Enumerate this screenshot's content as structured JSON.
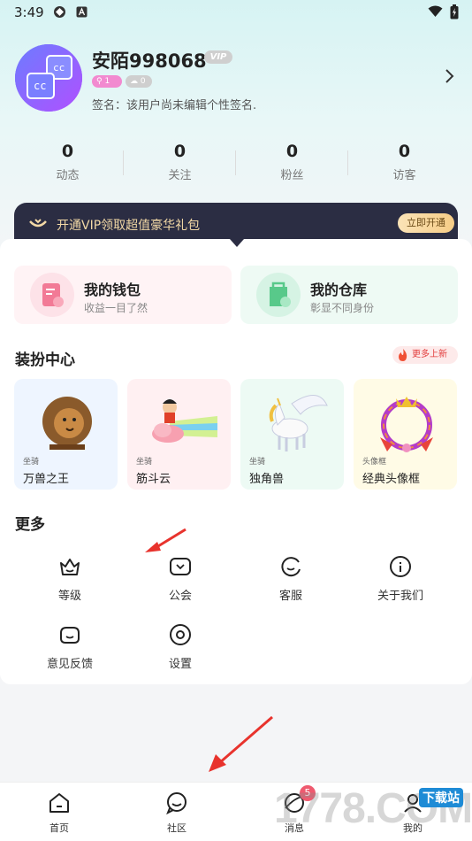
{
  "status_bar": {
    "time": "3:49"
  },
  "profile": {
    "name": "安陌998068",
    "vip_badge": "VIP",
    "badge_level": "1",
    "badge_gray": "0",
    "signature": "签名：该用户尚未编辑个性签名."
  },
  "stats": [
    {
      "value": "0",
      "label": "动态"
    },
    {
      "value": "0",
      "label": "关注"
    },
    {
      "value": "0",
      "label": "粉丝"
    },
    {
      "value": "0",
      "label": "访客"
    }
  ],
  "vip_banner": {
    "text": "开通VIP领取超值豪华礼包",
    "button": "立即开通"
  },
  "features": [
    {
      "title": "我的钱包",
      "subtitle": "收益一目了然"
    },
    {
      "title": "我的仓库",
      "subtitle": "彰显不同身份"
    }
  ],
  "dressup": {
    "title": "装扮中心",
    "hot_label": "更多上新",
    "items": [
      {
        "tag": "坐骑",
        "name": "万兽之王",
        "icon": "lion-icon"
      },
      {
        "tag": "坐骑",
        "name": "筋斗云",
        "icon": "cloud-rider-icon"
      },
      {
        "tag": "坐骑",
        "name": "独角兽",
        "icon": "unicorn-icon"
      },
      {
        "tag": "头像框",
        "name": "经典头像框",
        "icon": "avatar-frame-icon"
      }
    ]
  },
  "more": {
    "title": "更多",
    "items": [
      {
        "label": "等级",
        "icon": "crown-icon"
      },
      {
        "label": "公会",
        "icon": "shield-icon"
      },
      {
        "label": "客服",
        "icon": "service-icon"
      },
      {
        "label": "关于我们",
        "icon": "info-icon"
      },
      {
        "label": "意见反馈",
        "icon": "feedback-icon"
      },
      {
        "label": "设置",
        "icon": "settings-icon"
      }
    ]
  },
  "bottom_nav": {
    "items": [
      {
        "label": "首页",
        "icon": "home-icon"
      },
      {
        "label": "社区",
        "icon": "community-icon"
      },
      {
        "label": "消息",
        "icon": "message-icon",
        "badge": "5"
      },
      {
        "label": "我的",
        "icon": "profile-icon"
      }
    ]
  },
  "watermark": {
    "text": "1778.COM",
    "tag": "下载站"
  },
  "colors": {
    "accent_teal": "#d6f3f3",
    "vip_dark": "#2b2d43",
    "gold": "#f6cc86",
    "red": "#e8332d"
  }
}
